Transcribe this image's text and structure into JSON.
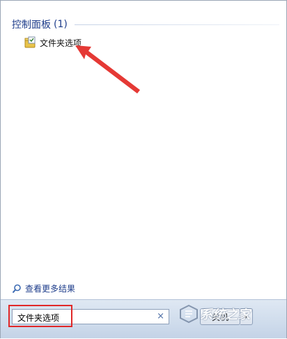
{
  "results": {
    "group_title": "控制面板",
    "group_count": "(1)",
    "items": [
      {
        "label": "文件夹选项",
        "icon": "folder-options-icon"
      }
    ]
  },
  "see_more": {
    "label": "查看更多结果",
    "icon": "search-icon"
  },
  "search": {
    "value": "文件夹选项",
    "clear_glyph": "×"
  },
  "power_button": {
    "label": "关机",
    "arrow_glyph": "▸"
  },
  "watermark": {
    "text": "系统之家"
  },
  "colors": {
    "accent_text": "#1e3d8b",
    "highlight": "#e02828",
    "arrow": "#e53935"
  }
}
